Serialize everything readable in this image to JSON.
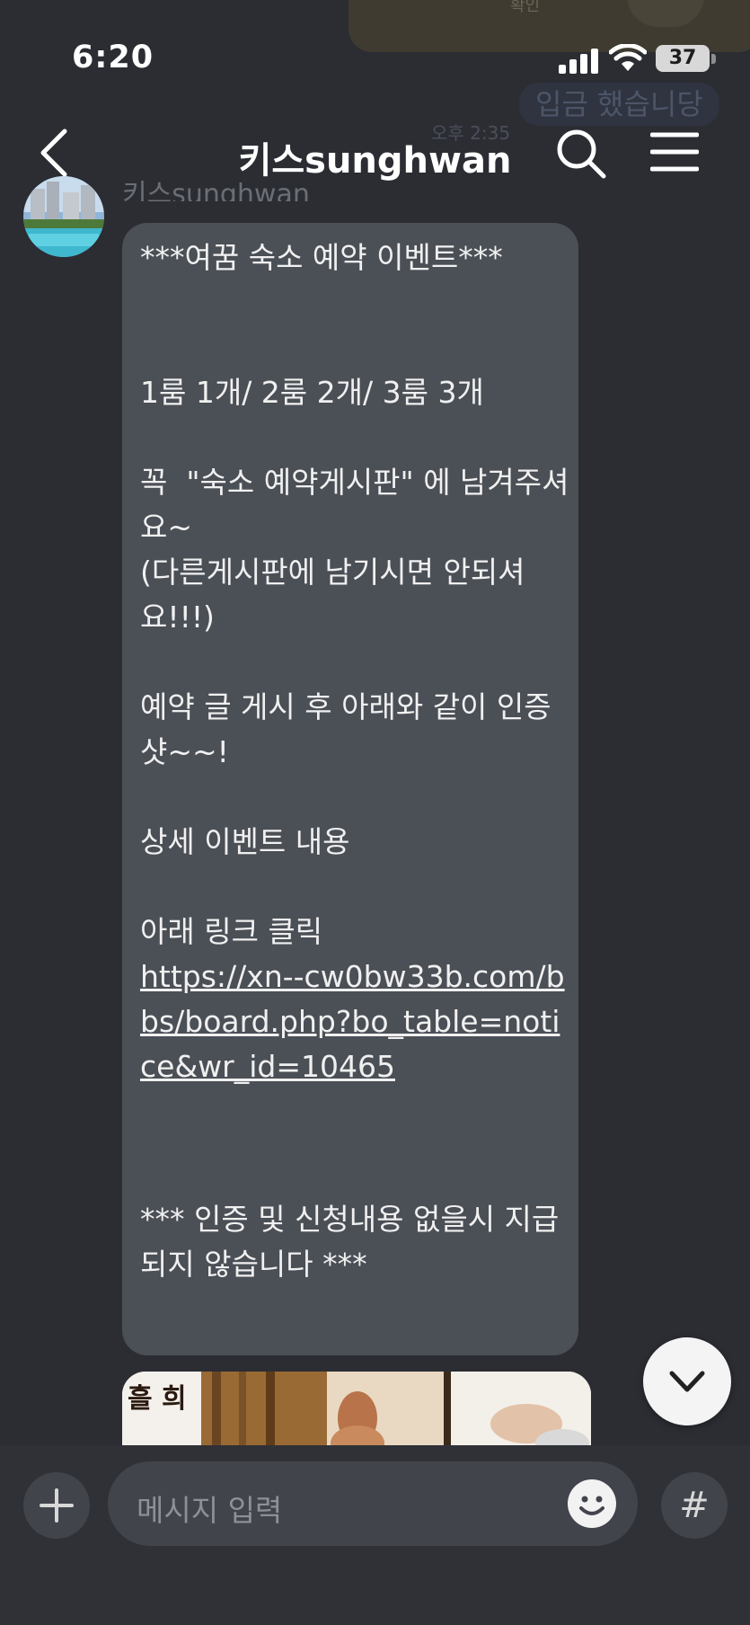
{
  "status_bar": {
    "time": "6:20",
    "battery_level": "37",
    "icons": [
      "signal-icon",
      "wifi-icon",
      "battery-icon"
    ]
  },
  "previous_message": {
    "bubble_text": "확인",
    "text": "입금 했습니당",
    "time": "오후 2:35"
  },
  "nav": {
    "title": "키스sunghwan",
    "icons": [
      "back-arrow-icon",
      "search-icon",
      "menu-icon"
    ]
  },
  "message": {
    "sender": "키스sunghwan",
    "body": "***여꿈 숙소 예약 이벤트***\n\n\n1룸 1개/ 2룸 2개/ 3룸 3개\n\n꼭  \"숙소 예약게시판\" 에 남겨주셔요~\n(다른게시판에 남기시면 안되셔요!!!)\n\n예약 글 게시 후 아래와 같이 인증샷~~!\n\n상세 이벤트 내용\n\n아래 링크 클릭",
    "link": "https://xn--cw0bw33b.com/bbs/board.php?bo_table=notice&wr_id=10465",
    "footer": "*** 인증 및 신청내용 없을시 지급되지 않습니다 ***"
  },
  "input_bar": {
    "placeholder": "메시지 입력",
    "hash_label": "#",
    "icons": [
      "plus-icon",
      "emoji-icon",
      "hash-icon"
    ]
  },
  "colors": {
    "background": "#2b2d33",
    "bubble": "#4b4f56",
    "input_bar": "#2f3137"
  }
}
